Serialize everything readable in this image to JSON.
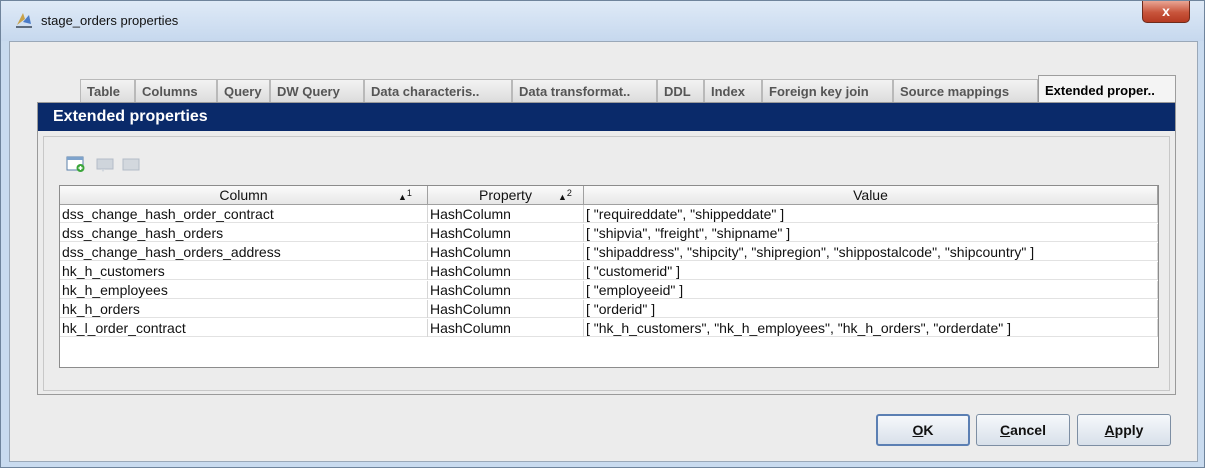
{
  "window": {
    "title": "stage_orders properties",
    "close_label": "x"
  },
  "tabs": [
    {
      "label": "Table"
    },
    {
      "label": "Columns"
    },
    {
      "label": "Query"
    },
    {
      "label": "DW Query"
    },
    {
      "label": "Data characteris.."
    },
    {
      "label": "Data transformat.."
    },
    {
      "label": "DDL"
    },
    {
      "label": "Index"
    },
    {
      "label": "Foreign key join"
    },
    {
      "label": "Source mappings"
    },
    {
      "label": "Extended proper.."
    }
  ],
  "active_tab": "Extended proper..",
  "panel": {
    "header": "Extended properties"
  },
  "toolbar": {
    "icons": [
      "add-row-icon",
      "edit-row-icon",
      "delete-row-icon"
    ]
  },
  "table": {
    "columns": [
      {
        "label": "Column",
        "sort_order": "1"
      },
      {
        "label": "Property",
        "sort_order": "2"
      },
      {
        "label": "Value",
        "sort_order": ""
      }
    ],
    "rows": [
      {
        "column": "dss_change_hash_order_contract",
        "property": "HashColumn",
        "value": "[ \"requireddate\", \"shippeddate\" ]"
      },
      {
        "column": "dss_change_hash_orders",
        "property": "HashColumn",
        "value": "[ \"shipvia\", \"freight\", \"shipname\" ]"
      },
      {
        "column": "dss_change_hash_orders_address",
        "property": "HashColumn",
        "value": "[ \"shipaddress\", \"shipcity\", \"shipregion\", \"shippostalcode\", \"shipcountry\" ]"
      },
      {
        "column": "hk_h_customers",
        "property": "HashColumn",
        "value": "[ \"customerid\" ]"
      },
      {
        "column": "hk_h_employees",
        "property": "HashColumn",
        "value": "[ \"employeeid\" ]"
      },
      {
        "column": "hk_h_orders",
        "property": "HashColumn",
        "value": "[ \"orderid\" ]"
      },
      {
        "column": "hk_l_order_contract",
        "property": "HashColumn",
        "value": "[ \"hk_h_customers\", \"hk_h_employees\", \"hk_h_orders\", \"orderdate\" ]"
      }
    ]
  },
  "buttons": {
    "ok": {
      "mnemonic": "O",
      "rest": "K"
    },
    "cancel": {
      "mnemonic": "C",
      "rest": "ancel"
    },
    "apply": {
      "mnemonic": "A",
      "rest": "pply"
    }
  }
}
